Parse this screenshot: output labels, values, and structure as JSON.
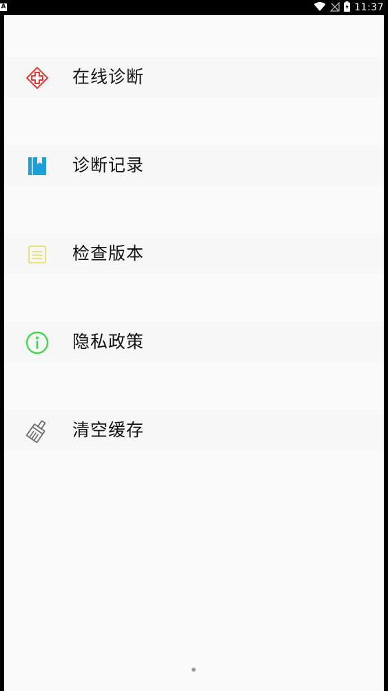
{
  "status_bar": {
    "left_badge": "A",
    "time": "11:37"
  },
  "menu": {
    "items": [
      {
        "label": "在线诊断",
        "icon": "medical-cross-icon",
        "color": "#e53935"
      },
      {
        "label": "诊断记录",
        "icon": "book-bookmark-icon",
        "color": "#1e88e5"
      },
      {
        "label": "检查版本",
        "icon": "document-icon",
        "color": "#e6e07a"
      },
      {
        "label": "隐私政策",
        "icon": "info-icon",
        "color": "#43d84a"
      },
      {
        "label": "清空缓存",
        "icon": "broom-icon",
        "color": "#6d6d6d"
      }
    ]
  }
}
